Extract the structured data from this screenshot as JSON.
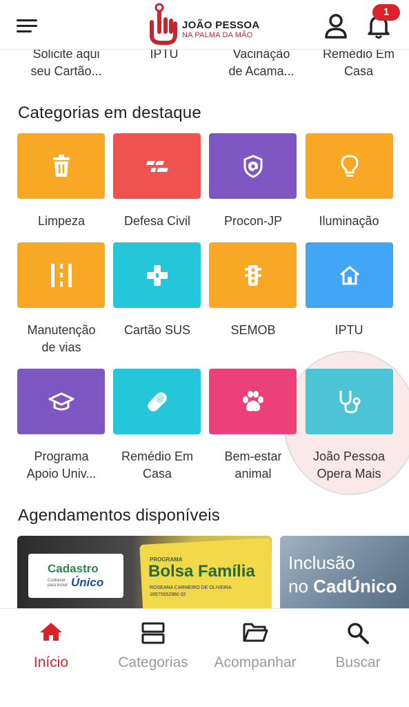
{
  "header": {
    "logo_title": "JOÃO PESSOA",
    "logo_subtitle": "NA PALMA DA MÃO",
    "notification_count": "1",
    "brand_color": "#d8232a"
  },
  "top_services": [
    {
      "label_line1": "Solicite aqui",
      "label_line2": "seu Cartão..."
    },
    {
      "label_line1": "IPTU",
      "label_line2": ""
    },
    {
      "label_line1": "Vacinação",
      "label_line2": "de Acama..."
    },
    {
      "label_line1": "Remédio Em",
      "label_line2": "Casa"
    }
  ],
  "categories_section": {
    "title": "Categorias em destaque",
    "items": [
      {
        "line1": "Limpeza",
        "line2": "",
        "icon": "trash-icon",
        "color": "#f9a825"
      },
      {
        "line1": "Defesa Civil",
        "line2": "",
        "icon": "civil-defense-icon",
        "color": "#ef5350"
      },
      {
        "line1": "Procon-JP",
        "line2": "",
        "icon": "shield-at-icon",
        "color": "#7e57c2"
      },
      {
        "line1": "Iluminação",
        "line2": "",
        "icon": "lightbulb-icon",
        "color": "#f9a825"
      },
      {
        "line1": "Manutenção",
        "line2": "de vias",
        "icon": "road-icon",
        "color": "#f9a825"
      },
      {
        "line1": "Cartão SUS",
        "line2": "",
        "icon": "health-cross-icon",
        "color": "#26c6da"
      },
      {
        "line1": "SEMOB",
        "line2": "",
        "icon": "traffic-light-icon",
        "color": "#f9a825"
      },
      {
        "line1": "IPTU",
        "line2": "",
        "icon": "house-icon",
        "color": "#42a5f5"
      },
      {
        "line1": "Programa",
        "line2": "Apoio Univ...",
        "icon": "graduation-cap-icon",
        "color": "#7e57c2"
      },
      {
        "line1": "Remédio Em",
        "line2": "Casa",
        "icon": "pill-icon",
        "color": "#26c6da"
      },
      {
        "line1": "Bem-estar",
        "line2": "animal",
        "icon": "paw-icon",
        "color": "#ec407a"
      },
      {
        "line1": "João Pessoa",
        "line2": "Opera Mais",
        "icon": "stethoscope-icon",
        "color": "#26c6da"
      }
    ]
  },
  "schedules_section": {
    "title": "Agendamentos disponíveis",
    "banner1": {
      "cad_line1": "Cadastro",
      "cad_small": "Conhecer para incluir",
      "cad_line2": "Único",
      "card_program": "PROGRAMA",
      "card_title": "Bolsa Família",
      "card_name": "ROSEANA CARNEIRO DE OLIVEIRA",
      "card_number": "16575552960 02"
    },
    "banner2": {
      "line1": "Inclusão",
      "line2_prefix": "no ",
      "line2_bold": "CadÚnico"
    }
  },
  "bottom_nav": [
    {
      "label": "Início",
      "icon": "home-icon",
      "active": true
    },
    {
      "label": "Categorias",
      "icon": "categories-icon",
      "active": false
    },
    {
      "label": "Acompanhar",
      "icon": "folder-icon",
      "active": false
    },
    {
      "label": "Buscar",
      "icon": "search-icon",
      "active": false
    }
  ]
}
